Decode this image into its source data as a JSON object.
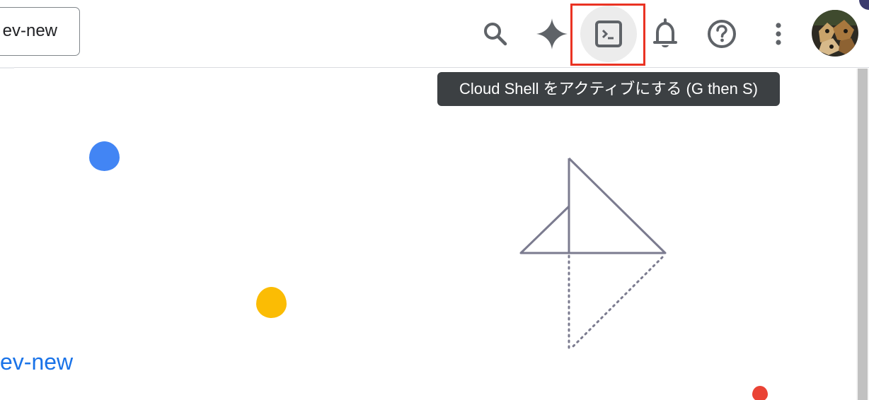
{
  "header": {
    "project_picker_label": "ev-new",
    "icons": {
      "search": "search-icon",
      "gemini": "gemini-sparkle-icon",
      "cloud_shell": "terminal-icon",
      "notifications": "bell-icon",
      "help": "help-icon",
      "more": "more-vert-icon",
      "avatar": "account-avatar"
    }
  },
  "tooltip": {
    "text": "Cloud Shell をアクティブにする (G then S)"
  },
  "main": {
    "project_link": "ev-new"
  },
  "colors": {
    "highlight": "#ea3323",
    "tooltip_bg": "#3c4043",
    "link": "#1a73e8",
    "dot_blue": "#4285f4",
    "dot_yellow": "#fbbc04",
    "dot_red": "#ea4335",
    "illustration_stroke": "#7b7b8f"
  }
}
